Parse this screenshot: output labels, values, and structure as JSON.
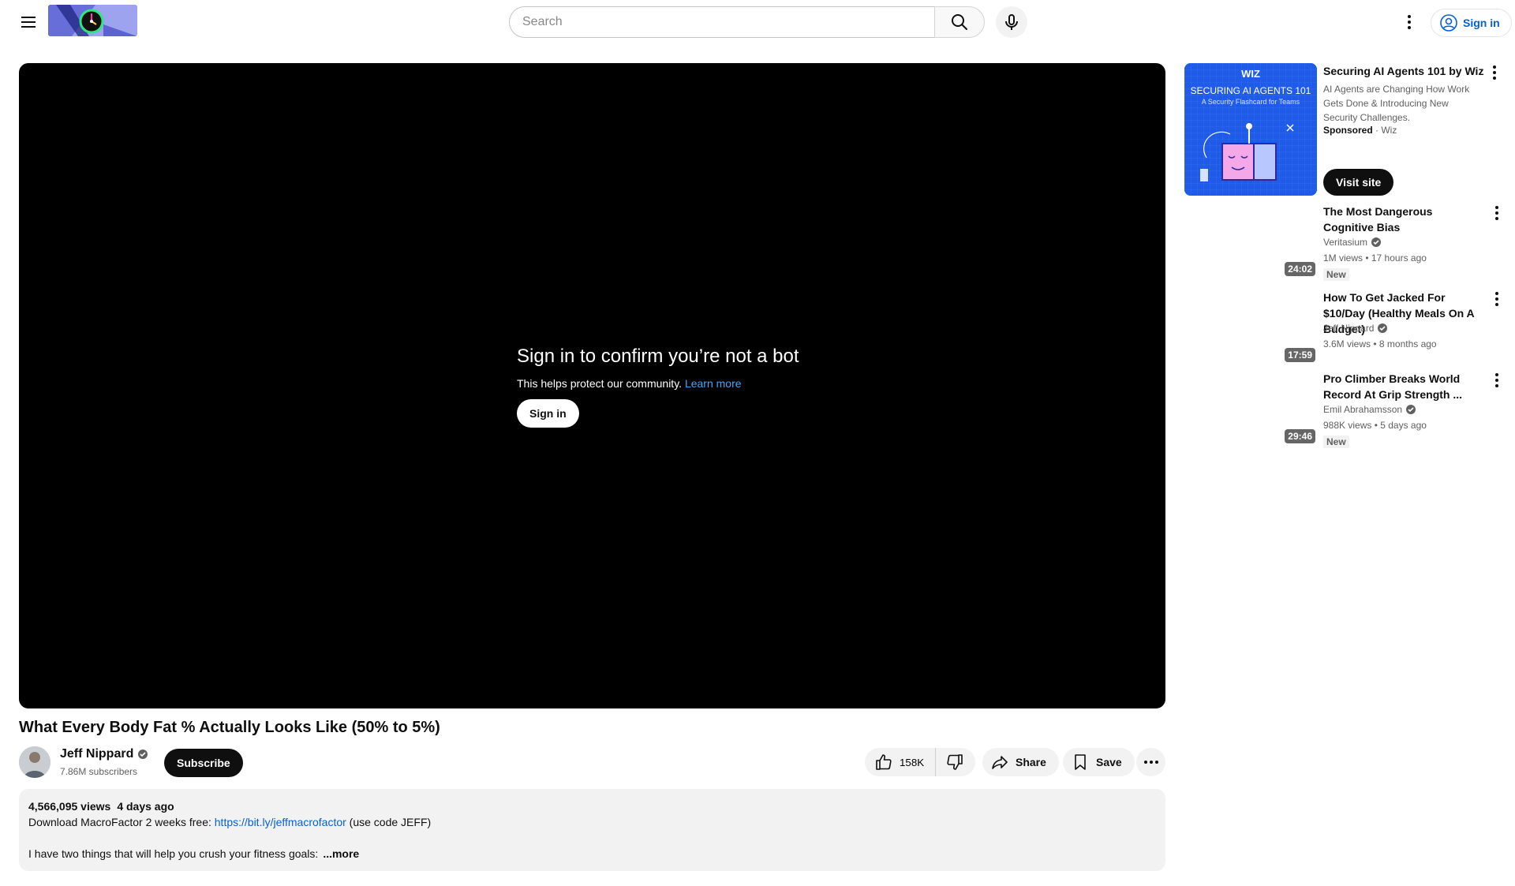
{
  "header": {
    "search_placeholder": "Search",
    "sign_in_label": "Sign in"
  },
  "player": {
    "bot_title": "Sign in to confirm you’re not a bot",
    "bot_subtitle": "This helps protect our community.",
    "learn_more": "Learn more",
    "sign_in_label": "Sign in"
  },
  "video": {
    "title": "What Every Body Fat % Actually Looks Like (50% to 5%)",
    "channel_name": "Jeff Nippard",
    "subscribers": "7.86M subscribers",
    "subscribe_label": "Subscribe",
    "likes": "158K",
    "share_label": "Share",
    "save_label": "Save"
  },
  "description": {
    "views": "4,566,095 views",
    "date": "4 days ago",
    "line1_prefix": "Download MacroFactor 2 weeks free: ",
    "line1_link": "https://bit.ly/jeffmacrofactor",
    "line1_suffix": " (use code JEFF)",
    "line2": "I have two things that will help you crush your fitness goals:",
    "more_label": "...more"
  },
  "ad": {
    "title": "Securing AI Agents 101 by Wiz",
    "description": "AI Agents are Changing How Work Gets Done & Introducing New Security Challenges.",
    "sponsored": "Sponsored",
    "advertiser": "Wiz",
    "visit_label": "Visit site",
    "thumb_brand": "WIZ",
    "thumb_heading": "SECURING AI AGENTS 101",
    "thumb_sub": "A Security Flashcard for Teams"
  },
  "recommendations": [
    {
      "title": "The Most Dangerous Cognitive Bias",
      "channel": "Veritasium",
      "stats": "1M views • 17 hours ago",
      "duration": "24:02",
      "badge": "New"
    },
    {
      "title": "How To Get Jacked For $10/Day (Healthy Meals On A Budget)",
      "channel": "Jeff Nippard",
      "stats": "3.6M views • 8 months ago",
      "duration": "17:59",
      "badge": ""
    },
    {
      "title": "Pro Climber Breaks World Record At Grip Strength ...",
      "channel": "Emil Abrahamsson",
      "stats": "988K views • 5 days ago",
      "duration": "29:46",
      "badge": "New"
    }
  ],
  "colors": {
    "link_blue": "#065fd4",
    "player_link": "#3ea6ff",
    "ad_blue": "#1f5be8",
    "logo_bg": "#9ea3f0"
  }
}
